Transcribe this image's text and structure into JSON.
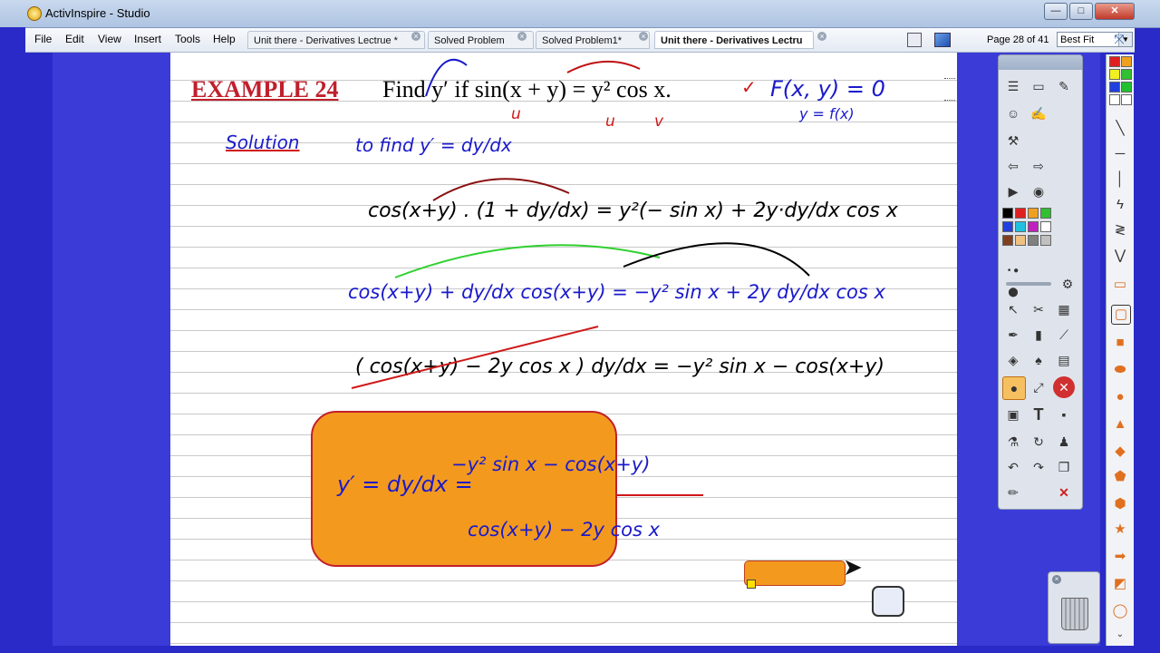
{
  "window": {
    "title": "ActivInspire - Studio",
    "minimize": "—",
    "maximize": "□",
    "close": "✕"
  },
  "menu": [
    "File",
    "Edit",
    "View",
    "Insert",
    "Tools",
    "Help"
  ],
  "tabs": [
    {
      "label": "Unit there - Derivatives Lectrue *",
      "active": false
    },
    {
      "label": "Solved Problem",
      "active": false
    },
    {
      "label": "Solved Problem1*",
      "active": false
    },
    {
      "label": "Unit there - Derivatives Lectru",
      "active": true
    }
  ],
  "page_indicator": "Page 28 of 41",
  "zoom": "Best Fit",
  "content": {
    "example_title": "EXAMPLE 24",
    "problem_text": "Find y′ if sin(x + y) = y² cos x.",
    "side_note_1": "F(x, y) = 0",
    "side_note_2": "y = f(x)",
    "solution_label": "Solution",
    "find_label": "to find y′ = dy/dx",
    "line1": "cos(x+y) . (1 + dy/dx) = y²(− sin x) + 2y·dy/dx cos x",
    "line2": "cos(x+y) + dy/dx cos(x+y) = −y² sin x + 2y dy/dx cos x",
    "line3": "( cos(x+y) − 2y cos x ) dy/dx = −y² sin x − cos(x+y)",
    "answer_lhs": "y′ = dy/dx =",
    "answer_num": "−y² sin x − cos(x+y)",
    "answer_den": "cos(x+y) − 2y cos x",
    "hand_u1": "u",
    "hand_u2": "u",
    "hand_v": "v"
  },
  "colors": {
    "accent_orange": "#f39a1e",
    "title_red": "#c0202c",
    "ink_blue": "#1a1acb",
    "ink_red": "#d01818",
    "canvas_blue": "#2a2ac8"
  }
}
